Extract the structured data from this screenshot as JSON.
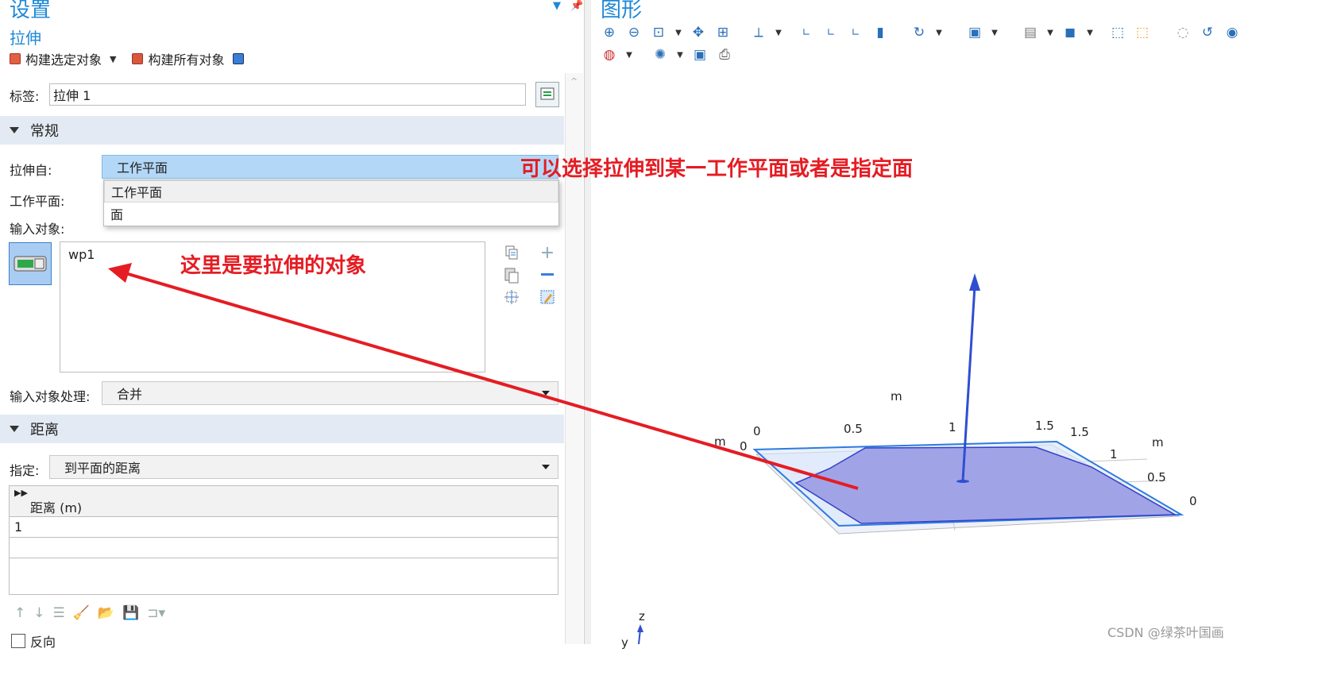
{
  "left_panel": {
    "title": "设置",
    "subtitle": "拉伸",
    "build_bar": {
      "build_selected": "构建选定对象",
      "build_all": "构建所有对象"
    },
    "label_row": {
      "label": "标签:",
      "value": "拉伸 1"
    },
    "general_section": {
      "title": "常规",
      "extrude_from_label": "拉伸自:",
      "extrude_from_value": "工作平面",
      "dropdown_options": [
        "工作平面",
        "面"
      ],
      "workplane_label": "工作平面:",
      "input_objects_label": "输入对象:",
      "input_objects": [
        "wp1"
      ],
      "input_handling_label": "输入对象处理:",
      "input_handling_value": "合并"
    },
    "distance_section": {
      "title": "距离",
      "specify_label": "指定:",
      "specify_value": "到平面的距离",
      "table_header": "距离 (m)",
      "table_rows": [
        "1"
      ]
    },
    "reverse_label": "反向"
  },
  "graphics_panel": {
    "title": "图形",
    "axis_labels": {
      "m_top": "m",
      "m_left": "m",
      "m_right": "m",
      "front_ticks": [
        "0",
        "0.5",
        "1",
        "1.5"
      ],
      "left_zero": "0",
      "side_ticks": [
        "1.5",
        "1",
        "0.5",
        "0"
      ],
      "z": "z",
      "y": "y"
    }
  },
  "annotations": {
    "dropdown_note": "可以选择拉伸到某一工作平面或者是指定面",
    "object_note": "这里是要拉伸的对象"
  },
  "watermark": "CSDN @绿茶叶国画",
  "colors": {
    "accent": "#1f88d6",
    "annotation_red": "#e51c23",
    "selection_fill": "#b3d8f7",
    "section_bg": "#e3eaf3",
    "shape_fill": "#a0a4e6",
    "arrow_blue": "#2f4fd1"
  }
}
